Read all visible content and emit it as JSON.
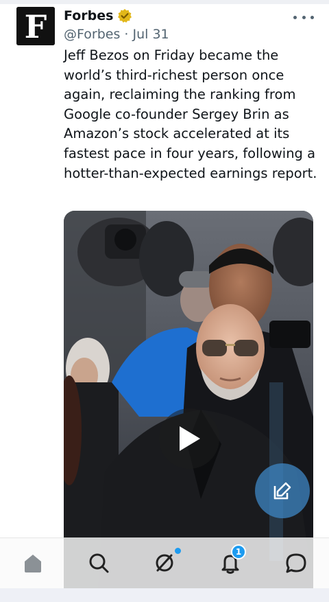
{
  "tweet": {
    "author_name": "Forbes",
    "handle": "@Forbes",
    "separator": "·",
    "date": "Jul 31",
    "avatar_letter": "F",
    "text": "Jeff Bezos on Friday became the world’s third-richest person once again, reclaiming the ranking from Google co-founder Sergey Brin as Amazon’s stock accelerated at its fastest pace in four years, following a hotter-than-expected earnings report.",
    "verified": true
  },
  "media": {
    "type": "video"
  },
  "bottom_nav": {
    "items": [
      "home-icon",
      "search-icon",
      "spaces-icon",
      "notifications-icon",
      "messages-icon"
    ],
    "notification_count": "1"
  },
  "colors": {
    "accent": "#1d9bf0",
    "verified_gold": "#e2b719",
    "text_primary": "#0f1419",
    "text_secondary": "#536471"
  }
}
